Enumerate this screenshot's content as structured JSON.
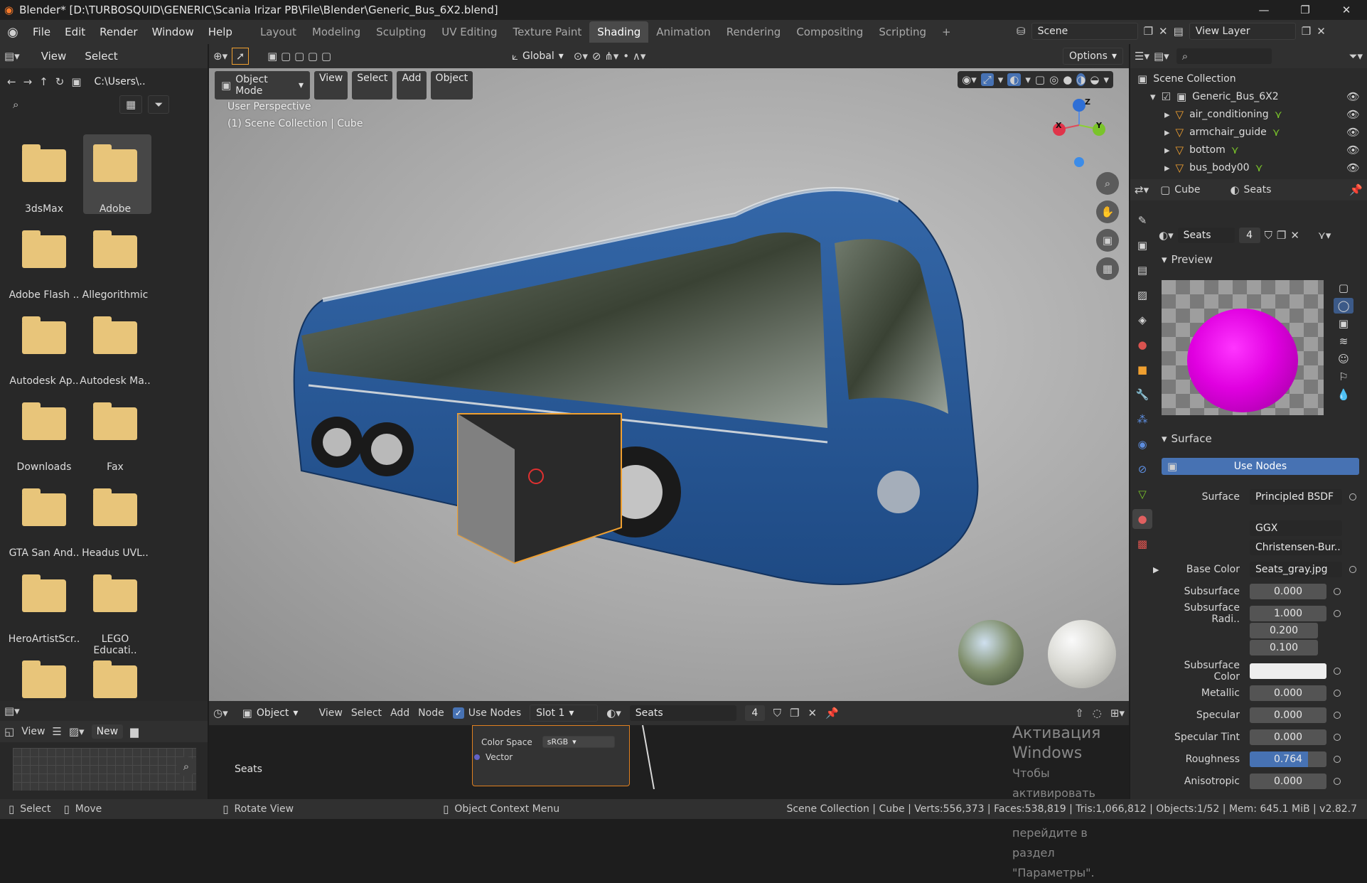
{
  "window": {
    "title": "Blender* [D:\\TURBOSQUID\\GENERIC\\Scania Irizar PB\\File\\Blender\\Generic_Bus_6X2.blend]",
    "minimize": "—",
    "maximize": "❐",
    "close": "✕"
  },
  "menu": [
    "File",
    "Edit",
    "Render",
    "Window",
    "Help"
  ],
  "workspaces": [
    "Layout",
    "Modeling",
    "Sculpting",
    "UV Editing",
    "Texture Paint",
    "Shading",
    "Animation",
    "Rendering",
    "Compositing",
    "Scripting"
  ],
  "workspace_active": "Shading",
  "add_workspace": "+",
  "scene": "Scene",
  "view_layer": "View Layer",
  "filebrowser": {
    "view": "View",
    "select": "Select",
    "path": "C:\\Users\\..",
    "folders": [
      "3dsMax",
      "Adobe",
      "Adobe Flash ..",
      "Allegorithmic",
      "Autodesk Ap..",
      "Autodesk Ma..",
      "Downloads",
      "Fax",
      "GTA San And..",
      "Headus UVL..",
      "HeroArtistScr..",
      "LEGO Educati..",
      "",
      ""
    ]
  },
  "viewport": {
    "mode": "Object Mode",
    "view": "View",
    "select": "Select",
    "add": "Add",
    "object": "Object",
    "transform": "Global",
    "options": "Options",
    "overlay_line1": "User Perspective",
    "overlay_line2": "(1) Scene Collection | Cube",
    "axis_x": "X",
    "axis_y": "Y",
    "axis_z": "Z"
  },
  "outliner": {
    "root": "Scene Collection",
    "collection": "Generic_Bus_6X2",
    "items": [
      "air_conditioning",
      "armchair_guide",
      "bottom",
      "bus_body00"
    ]
  },
  "properties": {
    "object": "Cube",
    "material_tab": "Seats",
    "material": "Seats",
    "users": "4",
    "preview_label": "Preview",
    "surface_label": "Surface",
    "use_nodes": "Use Nodes",
    "rows": [
      {
        "label": "Surface",
        "value": "Principled BSDF"
      },
      {
        "label": "",
        "value": "GGX"
      },
      {
        "label": "",
        "value": "Christensen-Bur.."
      },
      {
        "label": "Base Color",
        "value": "Seats_gray.jpg"
      },
      {
        "label": "Subsurface",
        "value": "0.000"
      },
      {
        "label": "Subsurface Radi..",
        "value": "1.000"
      },
      {
        "label": "",
        "value": "0.200"
      },
      {
        "label": "",
        "value": "0.100"
      },
      {
        "label": "Subsurface Color",
        "value": ""
      },
      {
        "label": "Metallic",
        "value": "0.000"
      },
      {
        "label": "Specular",
        "value": "0.000"
      },
      {
        "label": "Specular Tint",
        "value": "0.000"
      },
      {
        "label": "Roughness",
        "value": "0.764"
      },
      {
        "label": "Anisotropic",
        "value": "0.000"
      }
    ],
    "roughness_fill": 0.764
  },
  "node_editor": {
    "type": "Object",
    "view": "View",
    "select": "Select",
    "add": "Add",
    "node": "Node",
    "use_nodes": "Use Nodes",
    "slot": "Slot 1",
    "material": "Seats",
    "users": "4",
    "node_label": "Seats",
    "color_space_label": "Color Space",
    "color_space_value": "sRGB",
    "vector_label": "Vector"
  },
  "image_editor": {
    "view": "View",
    "new": "New"
  },
  "watermark": {
    "line1": "Активация Windows",
    "line2": "Чтобы активировать Windows, перейдите в раздел",
    "line3": "\"Параметры\"."
  },
  "statusbar": {
    "select": "Select",
    "move": "Move",
    "rotate": "Rotate View",
    "context": "Object Context Menu",
    "stats": "Scene Collection | Cube | Verts:556,373 | Faces:538,819 | Tris:1,066,812 | Objects:1/52 | Mem: 645.1 MiB | v2.82.7"
  },
  "colors": {
    "accent": "#4772b3",
    "bus_blue": "#2a5a9a",
    "material_preview": "#e600e6",
    "folder": "#e8c57a",
    "selection": "#f0a030"
  }
}
